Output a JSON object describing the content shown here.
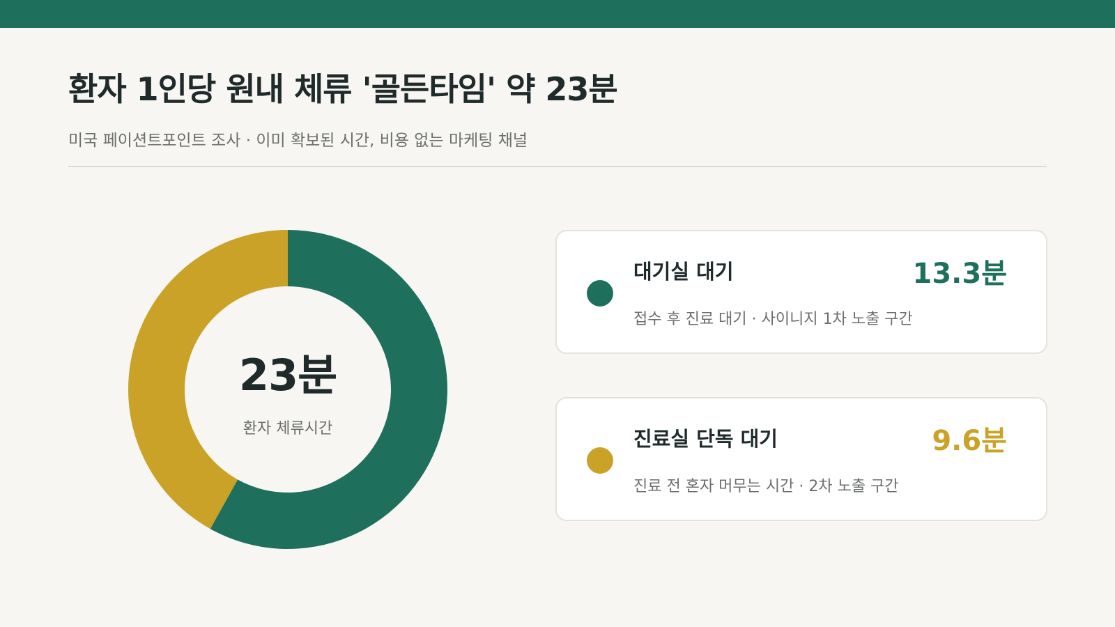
{
  "header": {
    "title": "환자 1인당 원내 체류 '골든타임' 약 23분",
    "subtitle": "미국 페이션트포인트 조사 · 이미 확보된 시간, 비용 없는 마케팅 채널"
  },
  "colors": {
    "brand": "#1e6f5c",
    "accent": "#c9a227",
    "background": "#f7f6f2"
  },
  "chart_data": {
    "type": "pie",
    "variant": "donut",
    "center_value": "23분",
    "center_label": "환자 체류시간",
    "series": [
      {
        "name": "대기실 대기",
        "value": 13.3,
        "value_label": "13.3분",
        "description": "접수 후 진료 대기 · 사이니지 1차 노출 구간",
        "color": "#1e6f5c"
      },
      {
        "name": "진료실 단독 대기",
        "value": 9.6,
        "value_label": "9.6분",
        "description": "진료 전 혼자 머무는 시간 · 2차 노출 구간",
        "color": "#c9a227"
      }
    ]
  }
}
